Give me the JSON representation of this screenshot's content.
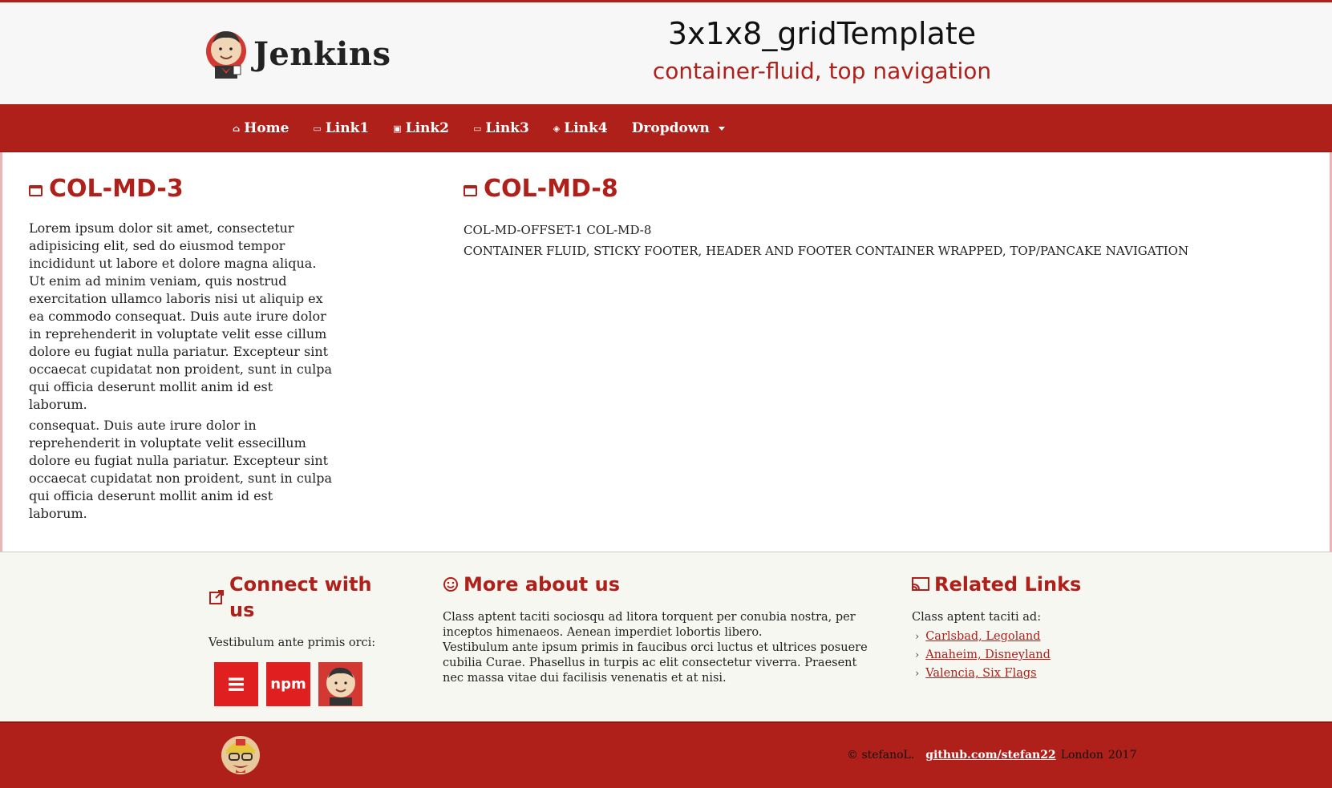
{
  "header": {
    "logo_text": "Jenkins",
    "title": "3x1x8_gridTemplate",
    "subtitle": "container-fluid, top navigation"
  },
  "nav": {
    "items": [
      {
        "label": "Home",
        "icon": "home-icon"
      },
      {
        "label": "Link1",
        "icon": "calendar-icon"
      },
      {
        "label": "Link2",
        "icon": "image-icon"
      },
      {
        "label": "Link3",
        "icon": "calendar-icon"
      },
      {
        "label": "Link4",
        "icon": "tag-icon"
      },
      {
        "label": "Dropdown",
        "icon": "caret-down-icon"
      }
    ]
  },
  "main": {
    "left": {
      "heading": "COL-MD-3",
      "para1": "Lorem ipsum dolor sit amet, consectetur adipisicing elit, sed do eiusmod tempor incididunt ut labore et dolore magna aliqua. Ut enim ad minim veniam, quis nostrud exercitation ullamco laboris nisi ut aliquip ex ea commodo consequat. Duis aute irure dolor in reprehenderit in voluptate velit esse cillum dolore eu fugiat nulla pariatur. Excepteur sint occaecat cupidatat non proident, sunt in culpa qui officia deserunt mollit anim id est laborum.",
      "para2": "consequat. Duis aute irure dolor in reprehenderit in voluptate velit essecillum dolore eu fugiat nulla pariatur. Excepteur sint occaecat cupidatat non proident, sunt in culpa qui officia deserunt mollit anim id est laborum."
    },
    "right": {
      "heading": "COL-MD-8",
      "line1": "COL-MD-OFFSET-1 COL-MD-8",
      "line2": "CONTAINER FLUID, STICKY FOOTER, HEADER AND FOOTER CONTAINER WRAPPED, TOP/PANCAKE NAVIGATION"
    }
  },
  "footer": {
    "connect": {
      "heading": "Connect with us",
      "text": "Vestibulum ante primis orci:",
      "badges": [
        {
          "name": "list-badge-icon",
          "label": "≡"
        },
        {
          "name": "npm-badge-icon",
          "label": "npm"
        },
        {
          "name": "jenkins-badge-icon",
          "label": ""
        }
      ]
    },
    "about": {
      "heading": "More about us",
      "text1": "Class aptent taciti sociosqu ad litora torquent per conubia nostra, per inceptos himenaeos. Aenean imperdiet lobortis libero.",
      "text2": "Vestibulum ante ipsum primis in faucibus orci luctus et ultrices posuere cubilia Curae. Phasellus in turpis ac elit consectetur viverra. Praesent nec massa vitae dui facilisis venenatis et at nisi."
    },
    "related": {
      "heading": "Related Links",
      "text": "Class aptent taciti ad:",
      "links": [
        "Carlsbad, Legoland",
        "Anaheim, Disneyland",
        "Valencia, Six Flags"
      ]
    },
    "bottom": {
      "copyright": "© stefanoL.",
      "github": "github.com/stefan22",
      "location": "London",
      "year": "2017"
    }
  },
  "colors": {
    "brand_red": "#b0201a",
    "badge_red": "#e02020",
    "header_bg": "#f7f7f7",
    "footer_bg": "#f7f7f2"
  }
}
